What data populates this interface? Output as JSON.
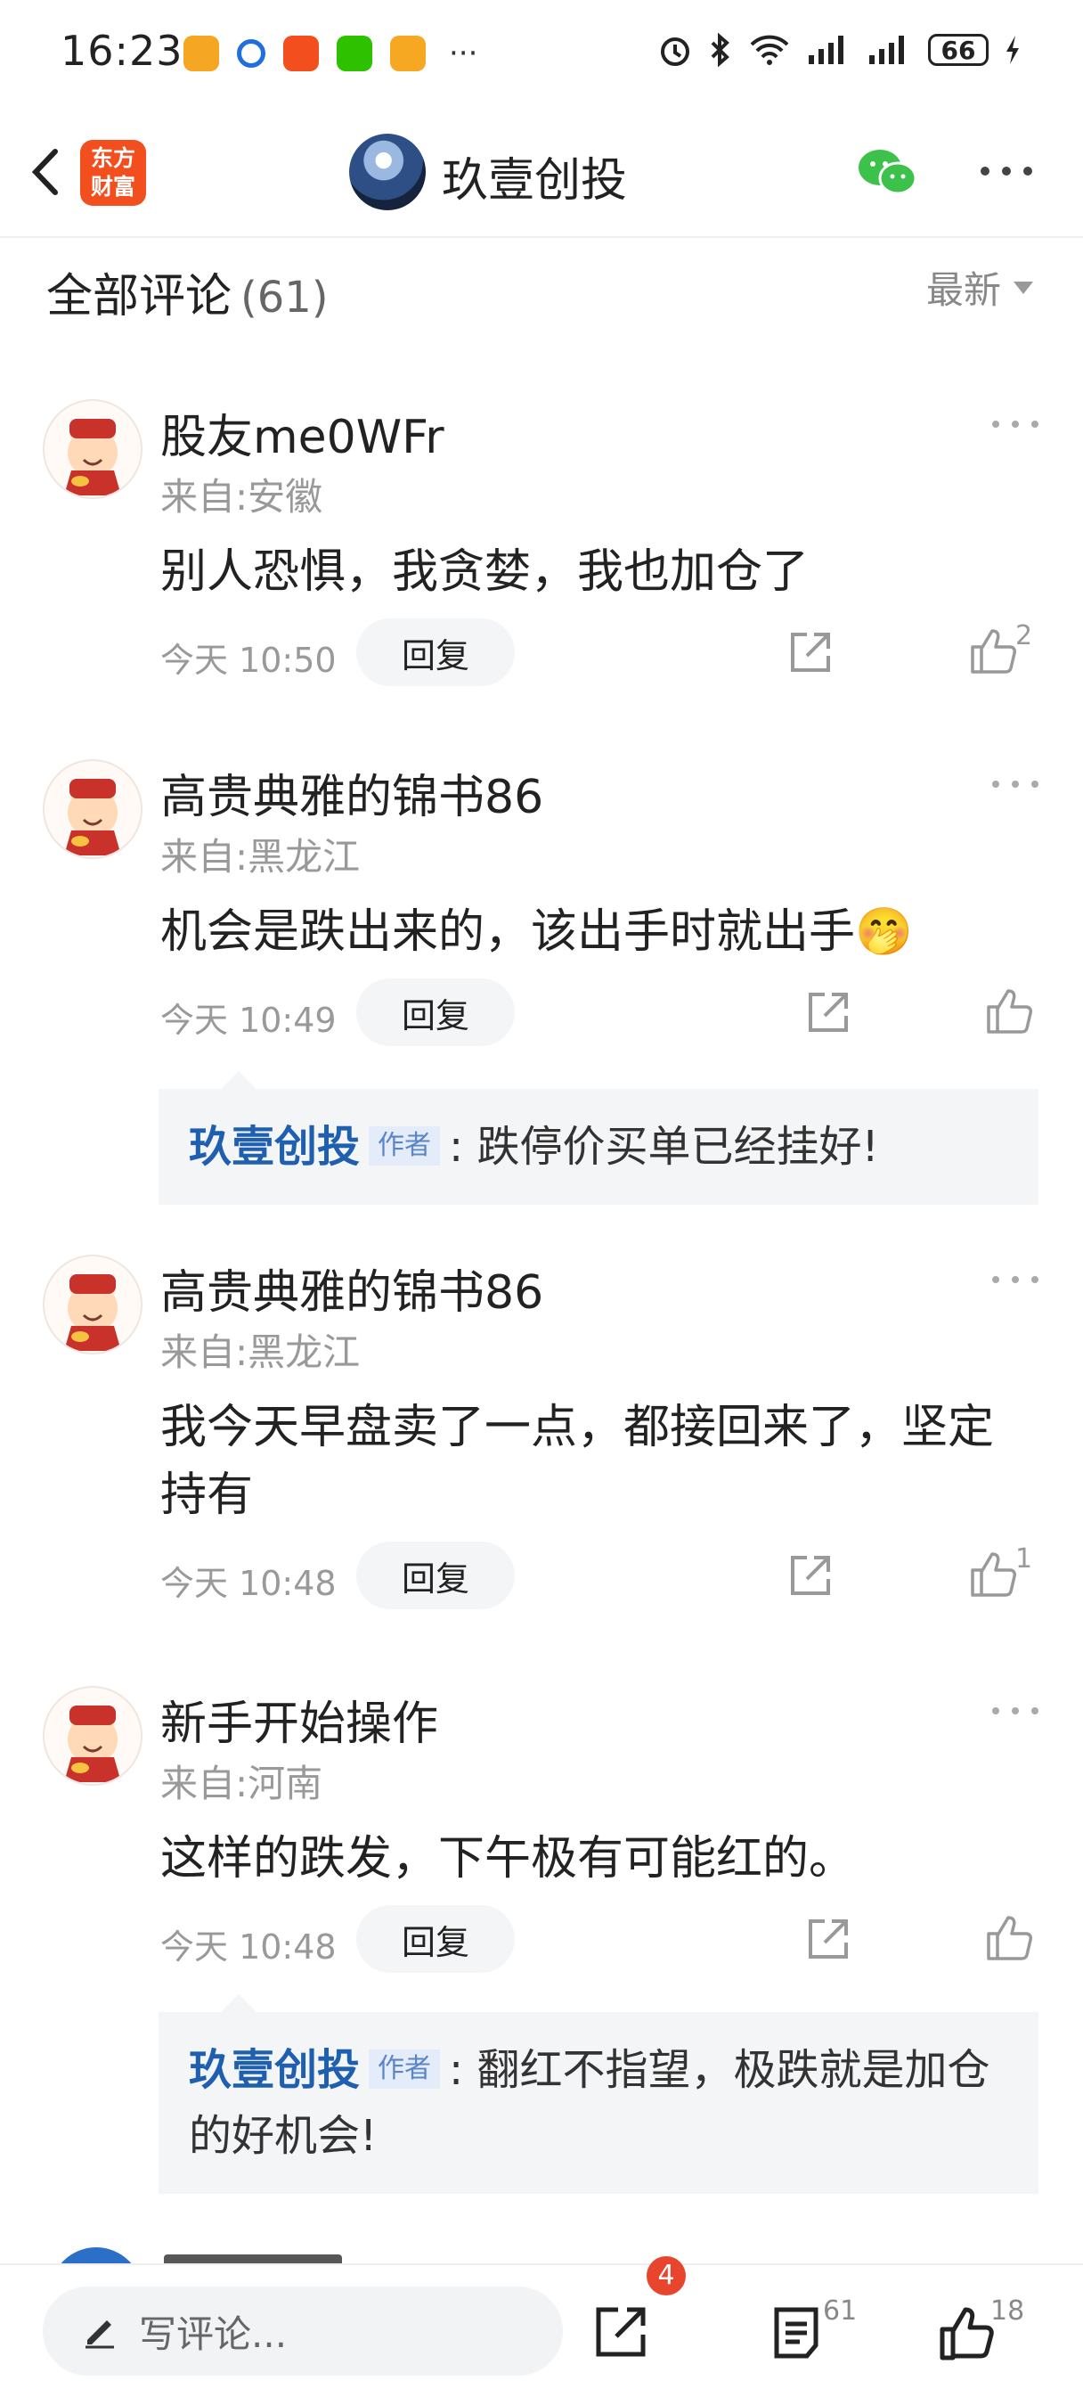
{
  "status_bar": {
    "time": "16:23",
    "battery": "66"
  },
  "header": {
    "app_logo_line1": "东方",
    "app_logo_line2": "财富",
    "title": "玖壹创投"
  },
  "comments_header": {
    "title": "全部评论",
    "count": "(61)",
    "sort_label": "最新"
  },
  "comments": [
    {
      "name": "股友me0WFr",
      "from": "来自:安徽",
      "text": "别人恐惧，我贪婪，我也加仓了",
      "time": "今天 10:50",
      "reply_label": "回复",
      "likes": "2"
    },
    {
      "name": "高贵典雅的锦书86",
      "from": "来自:黑龙江",
      "text": "机会是跌出来的，该出手时就出手🤭",
      "time": "今天 10:49",
      "reply_label": "回复",
      "likes": "",
      "author_reply": {
        "name": "玖壹创投",
        "tag": "作者",
        "text": ": 跌停价买单已经挂好!"
      }
    },
    {
      "name": "高贵典雅的锦书86",
      "from": "来自:黑龙江",
      "text": "我今天早盘卖了一点，都接回来了，坚定持有",
      "time": "今天 10:48",
      "reply_label": "回复",
      "likes": "1"
    },
    {
      "name": "新手开始操作",
      "from": "来自:河南",
      "text": "这样的跌发，下午极有可能红的。",
      "time": "今天 10:48",
      "reply_label": "回复",
      "likes": "",
      "author_reply": {
        "name": "玖壹创投",
        "tag": "作者",
        "text": ": 翻红不指望，极跌就是加仓的好机会!"
      }
    }
  ],
  "bottom_bar": {
    "composer_placeholder": "写评论...",
    "share_badge": "4",
    "comment_count": "61",
    "like_count": "18"
  },
  "colors": {
    "accent_blue": "#1f5fb0",
    "badge_red": "#e8452f",
    "brand_orange": "#f24e1e",
    "wechat_green": "#3cc24a"
  }
}
